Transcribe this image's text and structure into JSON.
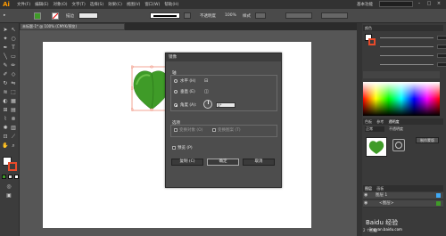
{
  "menubar": {
    "logo": "Ai",
    "items": [
      "文件(F)",
      "编辑(E)",
      "对象(O)",
      "文字(T)",
      "选择(S)",
      "效果(C)",
      "视图(V)",
      "窗口(W)",
      "帮助(H)"
    ],
    "workspace": "基本功能",
    "search_placeholder": ""
  },
  "control": {
    "stroke_label": "描边",
    "style_label": "不透明度",
    "style_value": "100%",
    "style2_label": "样式",
    "weight_value": ""
  },
  "doc_tab": "未标题-1* @ 100% (CMYK/预览)",
  "dialog": {
    "title": "镜像",
    "axis_label": "轴",
    "horizontal": "水平 (H)",
    "vertical": "垂直 (E)",
    "angle_label": "角度 (A):",
    "angle_value": "0°",
    "options_label": "选项",
    "opt_objects": "变换对象 (O)",
    "opt_patterns": "变换图案 (T)",
    "preview": "预览 (P)",
    "copy_button": "复制 (C)",
    "ok_button": "确定",
    "cancel_button": "取消"
  },
  "panels": {
    "color_tab": "颜色",
    "swatch_tab": "色板",
    "swatch2_tab": "参考",
    "transparency_tab": "透明度",
    "blend_mode": "正常",
    "opacity_label": "不透明度",
    "make_mask": "制作蒙版",
    "layers_tab": "图层",
    "artboards_tab": "画板",
    "layer1": "图层 1",
    "layer2": "<图层>",
    "layers_count": "2 个图层"
  },
  "watermark": "Baidu 经验",
  "watermark_url": "jingyan.baidu.com",
  "colors": {
    "accent": "#ff9a00",
    "leaf_green": "#3f9b28",
    "leaf_light": "#6cc04a",
    "selection": "#e84a2a"
  }
}
